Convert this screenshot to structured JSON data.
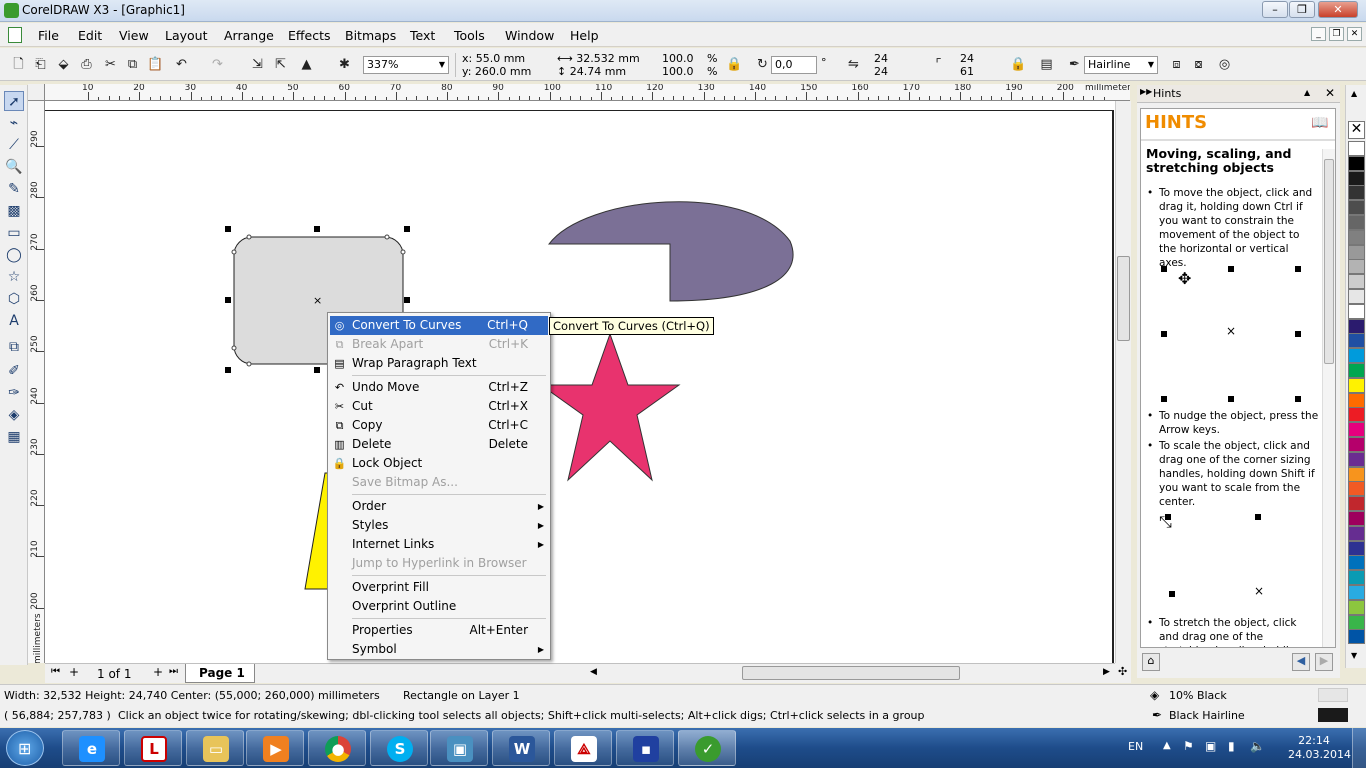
{
  "window": {
    "title": "CorelDRAW X3 - [Graphic1]"
  },
  "menu": [
    "File",
    "Edit",
    "View",
    "Layout",
    "Arrange",
    "Effects",
    "Bitmaps",
    "Text",
    "Tools",
    "Window",
    "Help"
  ],
  "property_bar": {
    "zoom": "337%",
    "x": "x: 55.0 mm",
    "y": "y: 260.0 mm",
    "width": "32.532 mm",
    "height": "24.74 mm",
    "scale_x": "100.0",
    "scale_y": "100.0",
    "percent": "%",
    "rotation": "0,0",
    "degree": "°",
    "corner_tl": "24",
    "corner_bl": "24",
    "corner_tr": "24",
    "corner_br": "61",
    "outline": "Hairline"
  },
  "ruler": {
    "h_ticks": [
      "10",
      "20",
      "30",
      "40",
      "50",
      "60",
      "70",
      "80",
      "90",
      "100",
      "110",
      "120",
      "130",
      "140",
      "150",
      "160",
      "170",
      "180",
      "190",
      "200"
    ],
    "v_ticks": [
      "290",
      "280",
      "270",
      "260",
      "250",
      "240",
      "230",
      "220",
      "210",
      "200"
    ],
    "unit": "millimeters"
  },
  "page_nav": {
    "counter": "1 of 1",
    "page_tab": "Page 1"
  },
  "context_menu": {
    "items": [
      {
        "label": "Convert To Curves",
        "shortcut": "Ctrl+Q",
        "icon": "convert-to-curves-icon",
        "state": "highlighted"
      },
      {
        "label": "Break  Apart",
        "shortcut": "Ctrl+K",
        "icon": "break-apart-icon",
        "state": "disabled"
      },
      {
        "label": "Wrap Paragraph Text",
        "shortcut": "",
        "icon": "wrap-text-icon",
        "state": "normal"
      },
      {
        "label": "Undo Move",
        "shortcut": "Ctrl+Z",
        "icon": "undo-icon",
        "state": "normal"
      },
      {
        "label": "Cut",
        "shortcut": "Ctrl+X",
        "icon": "scissors-icon",
        "state": "normal"
      },
      {
        "label": "Copy",
        "shortcut": "Ctrl+C",
        "icon": "copy-icon",
        "state": "normal"
      },
      {
        "label": "Delete",
        "shortcut": "Delete",
        "icon": "delete-icon",
        "state": "normal"
      },
      {
        "label": "Lock Object",
        "shortcut": "",
        "icon": "lock-icon",
        "state": "normal"
      },
      {
        "label": "Save Bitmap As...",
        "shortcut": "",
        "icon": "",
        "state": "disabled"
      },
      {
        "label": "Order",
        "shortcut": "",
        "icon": "",
        "state": "submenu"
      },
      {
        "label": "Styles",
        "shortcut": "",
        "icon": "",
        "state": "submenu"
      },
      {
        "label": "Internet Links",
        "shortcut": "",
        "icon": "",
        "state": "submenu"
      },
      {
        "label": "Jump to Hyperlink in Browser",
        "shortcut": "",
        "icon": "",
        "state": "disabled"
      },
      {
        "label": "Overprint Fill",
        "shortcut": "",
        "icon": "",
        "state": "normal"
      },
      {
        "label": "Overprint Outline",
        "shortcut": "",
        "icon": "",
        "state": "normal"
      },
      {
        "label": "Properties",
        "shortcut": "Alt+Enter",
        "icon": "",
        "state": "normal"
      },
      {
        "label": "Symbol",
        "shortcut": "",
        "icon": "",
        "state": "submenu"
      }
    ],
    "tooltip": "Convert To Curves (Ctrl+Q)"
  },
  "docker": {
    "tab": "Hints",
    "title": "HINTS",
    "heading": "Moving, scaling, and stretching objects",
    "hint1": "To move the object, click and drag it, holding down Ctrl if you want to constrain the movement of the object to the horizontal or vertical axes.",
    "hint2": "To nudge the object, press the Arrow keys.",
    "hint3": "To scale the object, click and drag one of the corner sizing handles, holding down Shift if you want to scale from the center.",
    "hint4": "To stretch the object, click and drag one of the stretching handles, holding down Shift if"
  },
  "palette": [
    "#ffffff",
    "#000000",
    "#1a1a1a",
    "#333333",
    "#4d4d4d",
    "#666666",
    "#808080",
    "#999999",
    "#b3b3b3",
    "#cccccc",
    "#e6e6e6",
    "#ffffff",
    "#2b1b6e",
    "#1f4fa3",
    "#009bdc",
    "#00a650",
    "#fff200",
    "#ff6b00",
    "#ed1c24",
    "#e6007e",
    "#b5006b",
    "#6b2c91",
    "#f7941d",
    "#f15a24",
    "#c1272d",
    "#9e005d",
    "#662d91",
    "#2e3192",
    "#0071bc",
    "#0a9bb3",
    "#29abe2",
    "#8cc63f",
    "#39b54a",
    "#0054a6"
  ],
  "status": {
    "size": "Width: 32,532 Height: 24,740 Center: (55,000; 260,000)  millimeters",
    "object": "Rectangle on Layer 1",
    "coords": "( 56,884; 257,783 )",
    "hint": "Click an object twice for rotating/skewing; dbl-clicking tool selects all objects; Shift+click multi-selects; Alt+click digs; Ctrl+click selects in a group",
    "fill": "10% Black",
    "outline": "Black  Hairline"
  },
  "taskbar": {
    "lang": "EN",
    "time": "22:14",
    "date": "24.03.2014"
  }
}
